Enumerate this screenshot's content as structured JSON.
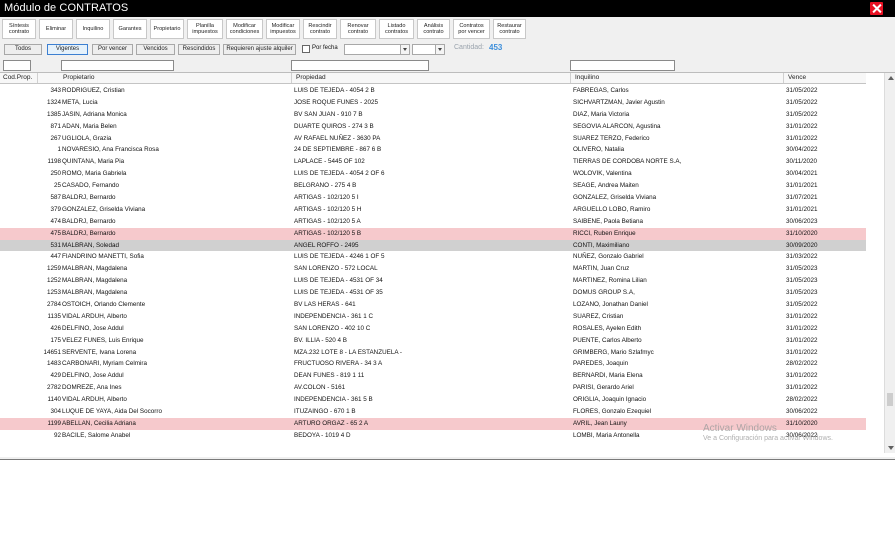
{
  "window": {
    "title": "Módulo de CONTRATOS"
  },
  "toolbar": [
    {
      "label": "Síntesis\ncontrato",
      "w": 34
    },
    {
      "label": "Eliminar",
      "w": 34
    },
    {
      "label": "Inquilino",
      "w": 34
    },
    {
      "label": "Garantes",
      "w": 34
    },
    {
      "label": "Propietario",
      "w": 34
    },
    {
      "label": "Planilla\nimpuestos",
      "w": 36
    },
    {
      "label": "Modificar\ncondiciones",
      "w": 37
    },
    {
      "label": "Modificar\nimpuestos",
      "w": 34
    },
    {
      "label": "Rescindir\ncontrato",
      "w": 34
    },
    {
      "label": "Renovar\ncontrato",
      "w": 36
    },
    {
      "label": "Listado\ncontratos",
      "w": 35
    },
    {
      "label": "Análisis\ncontrato",
      "w": 33
    },
    {
      "label": "Contratos\npor vencer",
      "w": 37
    },
    {
      "label": "Restaurar\ncontrato",
      "w": 33
    }
  ],
  "filters": [
    {
      "label": "Todos",
      "active": false
    },
    {
      "label": "Vigentes",
      "active": true
    },
    {
      "label": "Por vencer",
      "active": false
    },
    {
      "label": "Vencidos",
      "active": false
    },
    {
      "label": "Rescindidos",
      "active": false
    },
    {
      "label": "Requieren ajuste alquiler",
      "active": false
    }
  ],
  "date_filter": {
    "label": "Por fecha",
    "checked": false
  },
  "cantidad": {
    "label": "Cantidad:",
    "value": "453"
  },
  "columns": {
    "cod": "Cod.Prop.",
    "propietario": "Propietario",
    "propiedad": "Propiedad",
    "inquilino": "Inquilino",
    "vence": "Vence"
  },
  "rows": [
    {
      "cod": "343",
      "propietario": "RODRIGUEZ, Cristian",
      "propiedad": "LUIS DE TEJEDA - 4054 2 B",
      "inquilino": "FABREGAS, Carlos",
      "vence": "31/05/2022",
      "hl": ""
    },
    {
      "cod": "1324",
      "propietario": "META, Lucia",
      "propiedad": "JOSE ROQUE FUNES - 2025",
      "inquilino": "SICHVARTZMAN, Javier Agustin",
      "vence": "31/05/2022",
      "hl": ""
    },
    {
      "cod": "1385",
      "propietario": "JASIN, Adriana Monica",
      "propiedad": "BV SAN JUAN - 910 7 B",
      "inquilino": "DIAZ, Maria Victoria",
      "vence": "31/05/2022",
      "hl": ""
    },
    {
      "cod": "871",
      "propietario": "ADAN, Maria Belen",
      "propiedad": "DUARTE QUIROS - 274 3 B",
      "inquilino": "SEGOVIA ALARCON, Agustina",
      "vence": "31/01/2022",
      "hl": ""
    },
    {
      "cod": "267",
      "propietario": "UGLIOLA, Grazia",
      "propiedad": "AV RAFAEL NUÑEZ - 3630 PA",
      "inquilino": "SUAREZ TERZO, Federico",
      "vence": "31/01/2022",
      "hl": ""
    },
    {
      "cod": "1",
      "propietario": "NOVARESIO, Ana Francisca Rosa",
      "propiedad": "24 DE SEPTIEMBRE - 867 6 B",
      "inquilino": "OLIVERO, Natalia",
      "vence": "30/04/2022",
      "hl": ""
    },
    {
      "cod": "1198",
      "propietario": "QUINTANA, Maria Pia",
      "propiedad": "LAPLACE - 5445 OF 102",
      "inquilino": "TIERRAS DE CORDOBA NORTE S.A,",
      "vence": "30/11/2020",
      "hl": ""
    },
    {
      "cod": "250",
      "propietario": "ROMO, Maria Gabriela",
      "propiedad": "LUIS DE TEJEDA - 4054 2 OF 6",
      "inquilino": "WOLOVIK, Valentina",
      "vence": "30/04/2021",
      "hl": ""
    },
    {
      "cod": "25",
      "propietario": "CASADO, Fernando",
      "propiedad": "BELGRANO - 275 4 B",
      "inquilino": "SEAGE, Andrea Maiten",
      "vence": "31/01/2021",
      "hl": ""
    },
    {
      "cod": "587",
      "propietario": "BALDRJ, Bernardo",
      "propiedad": "ARTIGAS - 102/120 5 I",
      "inquilino": "GONZALEZ, Griselda Viviana",
      "vence": "31/07/2021",
      "hl": ""
    },
    {
      "cod": "379",
      "propietario": "GONZALEZ, Griselda Viviana",
      "propiedad": "ARTIGAS - 102/120 5 H",
      "inquilino": "ARGUELLO LOBO, Ramiro",
      "vence": "31/01/2021",
      "hl": ""
    },
    {
      "cod": "474",
      "propietario": "BALDRJ, Bernardo",
      "propiedad": "ARTIGAS - 102/120 5 A",
      "inquilino": "SAIBENE, Paola Betiana",
      "vence": "30/06/2023",
      "hl": ""
    },
    {
      "cod": "475",
      "propietario": "BALDRJ, Bernardo",
      "propiedad": "ARTIGAS - 102/120 5 B",
      "inquilino": "RICCI, Ruben Enrique",
      "vence": "31/10/2020",
      "hl": "pink"
    },
    {
      "cod": "531",
      "propietario": "MALBRAN, Soledad",
      "propiedad": "ANGEL ROFFO - 2495",
      "inquilino": "CONTI, Maximiliano",
      "vence": "30/09/2020",
      "hl": "gray"
    },
    {
      "cod": "447",
      "propietario": "FIANDRINO MANETTI, Sofia",
      "propiedad": "LUIS DE TEJEDA - 4246 1 OF 5",
      "inquilino": "NUÑEZ, Gonzalo Gabriel",
      "vence": "31/03/2022",
      "hl": ""
    },
    {
      "cod": "1259",
      "propietario": "MALBRAN, Magdalena",
      "propiedad": "SAN LORENZO - 572 LOCAL",
      "inquilino": "MARTIN, Juan Cruz",
      "vence": "31/05/2023",
      "hl": ""
    },
    {
      "cod": "1252",
      "propietario": "MALBRAN, Magdalena",
      "propiedad": "LUIS DE TEJEDA - 4531 OF 34",
      "inquilino": "MARTINEZ, Romina Lilian",
      "vence": "31/05/2023",
      "hl": ""
    },
    {
      "cod": "1253",
      "propietario": "MALBRAN, Magdalena",
      "propiedad": "LUIS DE TEJEDA - 4531 OF 35",
      "inquilino": "DOMUS GROUP S.A,",
      "vence": "31/05/2023",
      "hl": ""
    },
    {
      "cod": "2784",
      "propietario": "OSTOICH, Orlando Clemente",
      "propiedad": "BV LAS HERAS - 641",
      "inquilino": "LOZANO, Jonathan Daniel",
      "vence": "31/05/2022",
      "hl": ""
    },
    {
      "cod": "1135",
      "propietario": "VIDAL ARDUH, Alberto",
      "propiedad": "INDEPENDENCIA - 361 1 C",
      "inquilino": "SUAREZ, Cristian",
      "vence": "31/01/2022",
      "hl": ""
    },
    {
      "cod": "426",
      "propietario": "DELFINO, Jose Addul",
      "propiedad": "SAN LORENZO - 402 10 C",
      "inquilino": "ROSALES, Ayelen Edith",
      "vence": "31/01/2022",
      "hl": ""
    },
    {
      "cod": "175",
      "propietario": "VELEZ FUNES, Luis Enrique",
      "propiedad": "BV. ILLIA - 520 4 B",
      "inquilino": "PUENTE, Carlos Alberto",
      "vence": "31/01/2022",
      "hl": ""
    },
    {
      "cod": "14651",
      "propietario": "SERVENTE, Ivana Lorena",
      "propiedad": "MZA.232 LOTE 8 - LA ESTANZUELA -",
      "inquilino": "GRIMBERG, Mario Szlafmyc",
      "vence": "31/01/2022",
      "hl": ""
    },
    {
      "cod": "1483",
      "propietario": "CARBONARI, Myriam Celmira",
      "propiedad": "FRUCTUOSO RIVERA - 34 3 A",
      "inquilino": "PAREDES, Joaquin",
      "vence": "28/02/2022",
      "hl": ""
    },
    {
      "cod": "429",
      "propietario": "DELFINO, Jose Addul",
      "propiedad": "DEAN FUNES - 819 1 11",
      "inquilino": "BERNARDI, Maria Elena",
      "vence": "31/01/2022",
      "hl": ""
    },
    {
      "cod": "2782",
      "propietario": "DOMREZE, Ana Ines",
      "propiedad": "AV.COLON - 5161",
      "inquilino": "PARISI, Gerardo Ariel",
      "vence": "31/01/2022",
      "hl": ""
    },
    {
      "cod": "1140",
      "propietario": "VIDAL ARDUH, Alberto",
      "propiedad": "INDEPENDENCIA - 361 5 B",
      "inquilino": "ORIGLIA, Joaquin Ignacio",
      "vence": "28/02/2022",
      "hl": ""
    },
    {
      "cod": "304",
      "propietario": "LUQUE DE YAYA, Aida Del Socorro",
      "propiedad": "ITUZAINGO - 670 1 B",
      "inquilino": "FLORES, Gonzalo Ezequiel",
      "vence": "30/06/2022",
      "hl": ""
    },
    {
      "cod": "1199",
      "propietario": "ABELLAN, Cecilia Adriana",
      "propiedad": "ARTURO ORGAZ - 65 2 A",
      "inquilino": "AVRIL, Jean Launy",
      "vence": "31/10/2020",
      "hl": "pink"
    },
    {
      "cod": "92",
      "propietario": "BACILE, Salome Anabel",
      "propiedad": "BEDOYA - 1019 4 D",
      "inquilino": "LOMBI, Maria Antonella",
      "vence": "30/06/2022",
      "hl": ""
    }
  ],
  "watermark": {
    "line1": "Activar Windows",
    "line2": "Ve a Configuración para activar Windows."
  }
}
